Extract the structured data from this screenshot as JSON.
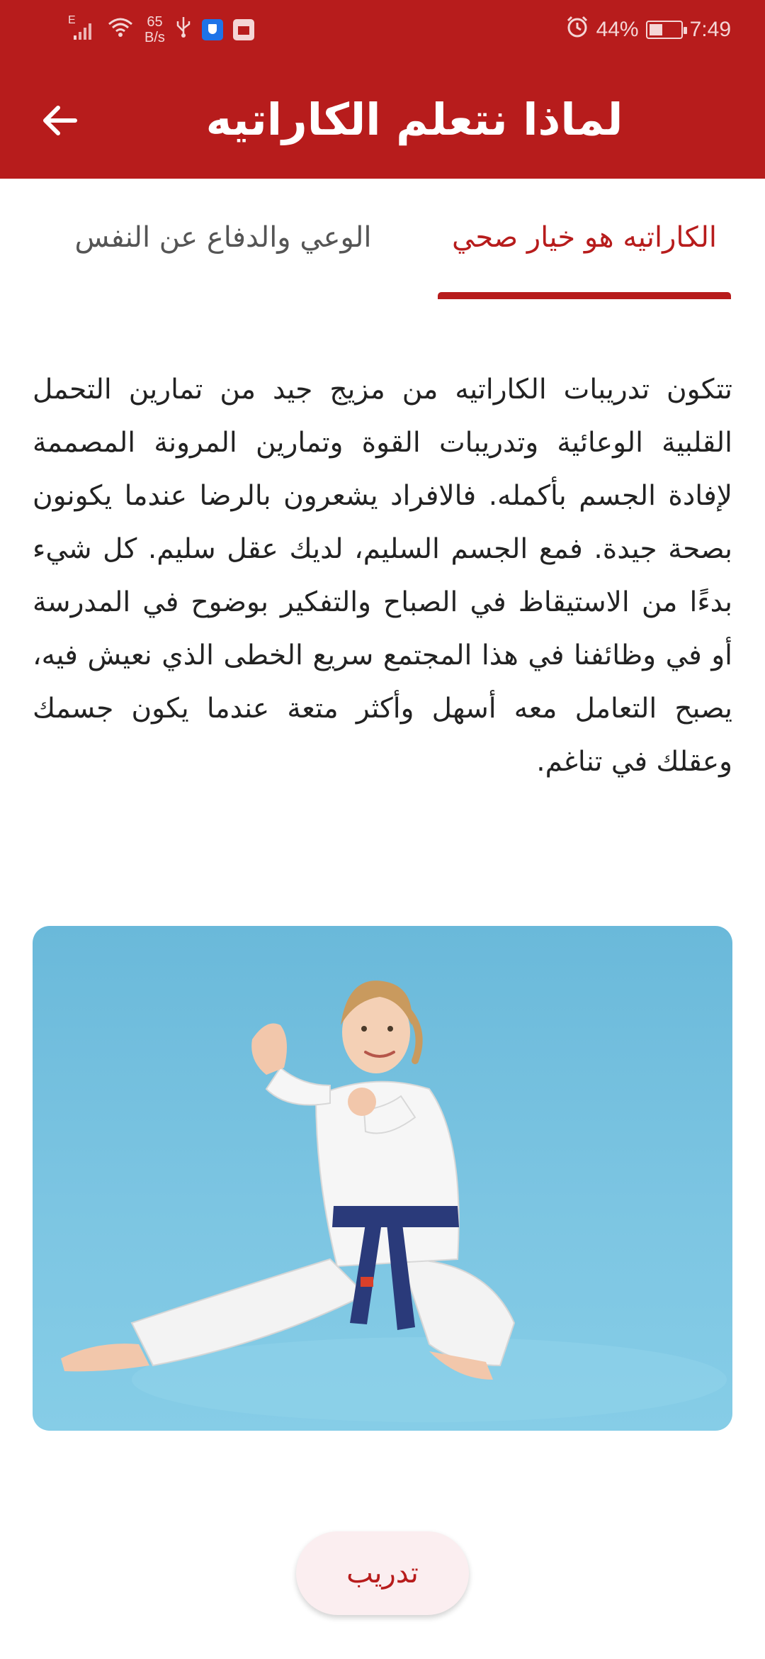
{
  "status_bar": {
    "network_type": "E",
    "net_speed_value": "65",
    "net_speed_unit": "B/s",
    "battery_percent": "44%",
    "battery_level": 0.44,
    "time": "7:49"
  },
  "app_bar": {
    "title": "لماذا نتعلم الكاراتيه"
  },
  "tabs": [
    {
      "label": "الكاراتيه هو خيار صحي",
      "active": true
    },
    {
      "label": "الوعي والدفاع عن النفس",
      "active": false
    }
  ],
  "content": {
    "paragraph": "تتكون تدريبات الكاراتيه من مزيج جيد من تمارين التحمل القلبية الوعائية وتدريبات القوة وتمارين المرونة المصممة لإفادة الجسم بأكمله. فالافراد يشعرون بالرضا عندما يكونون بصحة جيدة. فمع الجسم السليم، لديك عقل سليم. كل شيء بدءًا من الاستيقاظ في الصباح والتفكير بوضوح في المدرسة أو في وظائفنا في هذا المجتمع سريع الخطى الذي نعيش فيه، يصبح التعامل معه أسهل وأكثر متعة عندما يكون جسمك وعقلك في تناغم."
  },
  "actions": {
    "train_label": "تدريب"
  },
  "colors": {
    "primary": "#b71c1c",
    "button_bg": "#fbeef0",
    "text": "#222222",
    "tab_inactive": "#555555"
  },
  "icons": {
    "back": "arrow-left-icon",
    "wifi": "wifi-icon",
    "signal": "signal-icon",
    "usb": "usb-icon",
    "alarm": "alarm-icon",
    "battery": "battery-charging-icon"
  }
}
